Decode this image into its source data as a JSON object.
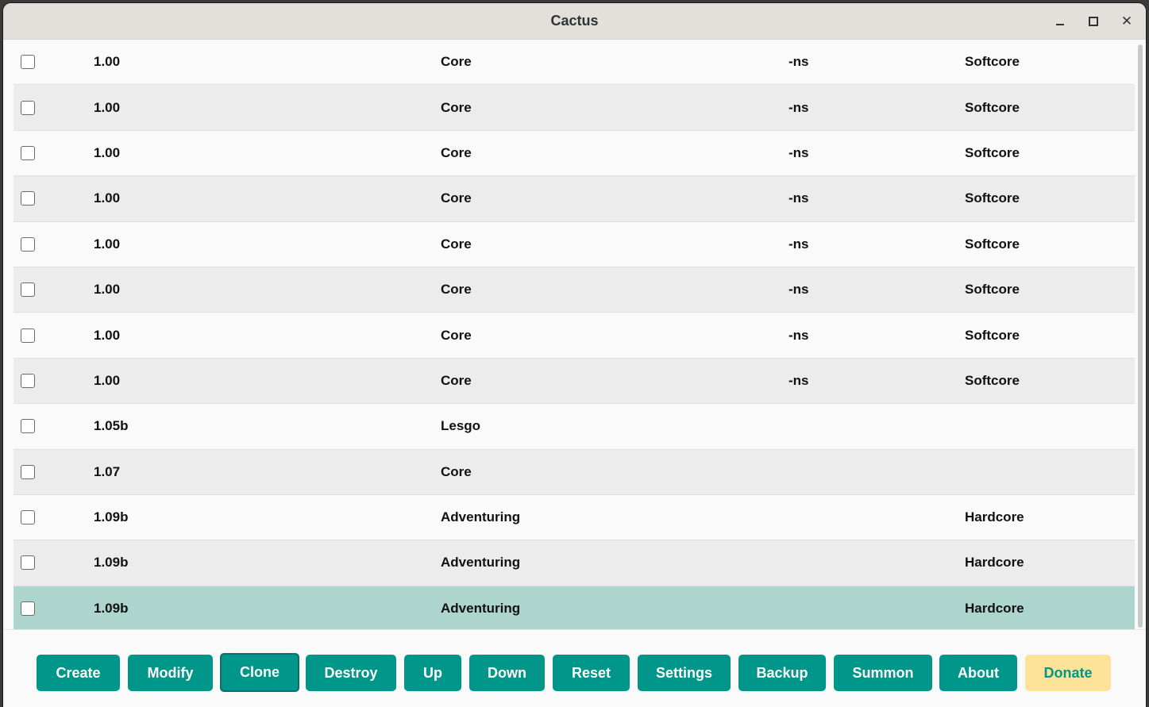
{
  "window": {
    "title": "Cactus"
  },
  "rows": [
    {
      "version": "1.00",
      "name": "Core",
      "suffix": "-ns",
      "mode": "Softcore"
    },
    {
      "version": "1.00",
      "name": "Core",
      "suffix": "-ns",
      "mode": "Softcore"
    },
    {
      "version": "1.00",
      "name": "Core",
      "suffix": "-ns",
      "mode": "Softcore"
    },
    {
      "version": "1.00",
      "name": "Core",
      "suffix": "-ns",
      "mode": "Softcore"
    },
    {
      "version": "1.00",
      "name": "Core",
      "suffix": "-ns",
      "mode": "Softcore"
    },
    {
      "version": "1.00",
      "name": "Core",
      "suffix": "-ns",
      "mode": "Softcore"
    },
    {
      "version": "1.00",
      "name": "Core",
      "suffix": "-ns",
      "mode": "Softcore"
    },
    {
      "version": "1.00",
      "name": "Core",
      "suffix": "-ns",
      "mode": "Softcore"
    },
    {
      "version": "1.05b",
      "name": "Lesgo",
      "suffix": "",
      "mode": ""
    },
    {
      "version": "1.07",
      "name": "Core",
      "suffix": "",
      "mode": ""
    },
    {
      "version": "1.09b",
      "name": "Adventuring",
      "suffix": "",
      "mode": "Hardcore"
    },
    {
      "version": "1.09b",
      "name": "Adventuring",
      "suffix": "",
      "mode": "Hardcore"
    },
    {
      "version": "1.09b",
      "name": "Adventuring",
      "suffix": "",
      "mode": "Hardcore",
      "selected": true
    }
  ],
  "buttons": {
    "create": "Create",
    "modify": "Modify",
    "clone": "Clone",
    "destroy": "Destroy",
    "up": "Up",
    "down": "Down",
    "reset": "Reset",
    "settings": "Settings",
    "backup": "Backup",
    "summon": "Summon",
    "about": "About",
    "donate": "Donate"
  },
  "colors": {
    "accent": "#00978a",
    "selected_row": "#aed5cd",
    "donate_bg": "#fde39a"
  }
}
